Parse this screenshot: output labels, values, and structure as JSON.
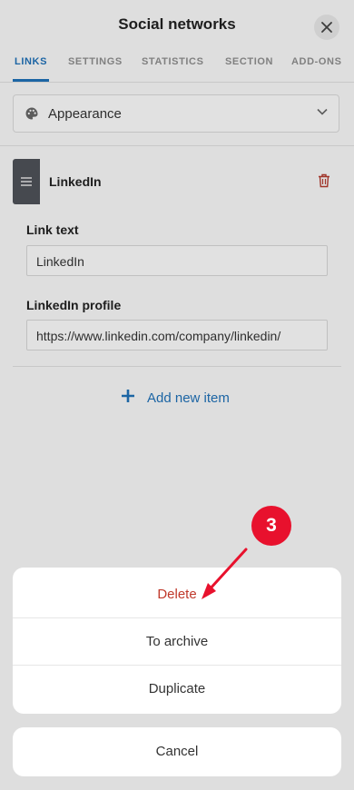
{
  "header": {
    "title": "Social networks"
  },
  "tabs": [
    {
      "label": "LINKS",
      "active": true
    },
    {
      "label": "SETTINGS",
      "active": false
    },
    {
      "label": "STATISTICS",
      "active": false
    },
    {
      "label": "SECTION",
      "active": false
    },
    {
      "label": "ADD-ONS",
      "active": false
    }
  ],
  "appearance": {
    "label": "Appearance",
    "icon": "palette-icon"
  },
  "item": {
    "title": "LinkedIn",
    "fields": [
      {
        "label": "Link text",
        "value": "LinkedIn"
      },
      {
        "label": "LinkedIn profile",
        "value": "https://www.linkedin.com/company/linkedin/"
      }
    ]
  },
  "add_new": {
    "label": "Add new item"
  },
  "step_badge": "3",
  "action_sheet": {
    "items": [
      {
        "label": "Delete",
        "style": "danger"
      },
      {
        "label": "To archive"
      },
      {
        "label": "Duplicate"
      }
    ],
    "cancel": "Cancel"
  },
  "colors": {
    "accent": "#1f6fb5",
    "danger": "#c0392b",
    "badge": "#e8112d"
  }
}
